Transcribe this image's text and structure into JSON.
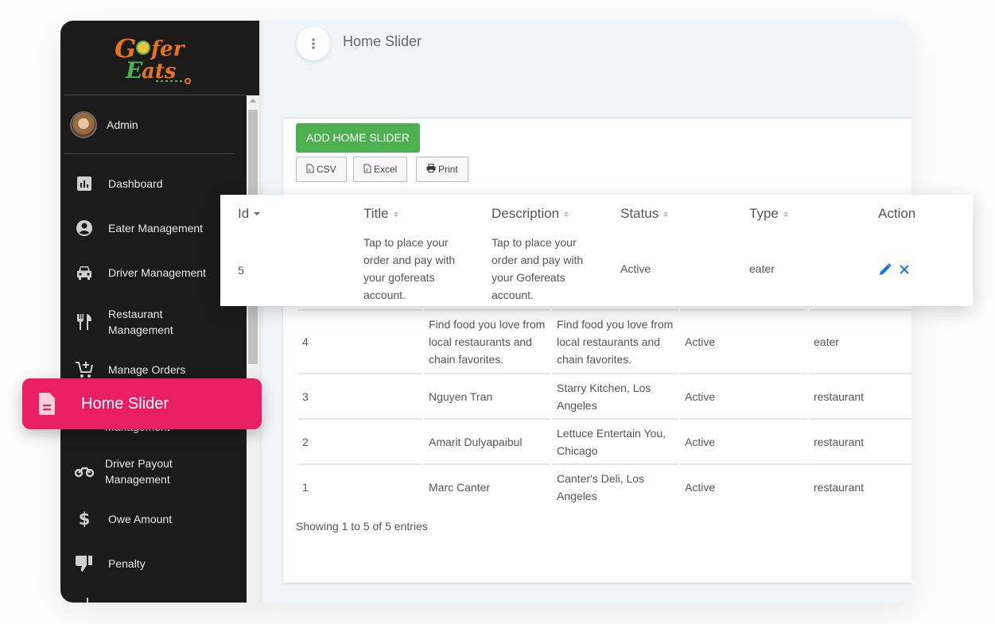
{
  "brand": {
    "logo_text_top": "Gofer",
    "logo_text_bottom": "Eats"
  },
  "user": {
    "name": "Admin"
  },
  "sidebar": {
    "items": [
      {
        "label": "Dashboard",
        "icon": "bar-chart-icon"
      },
      {
        "label": "Eater Management",
        "icon": "user-circle-icon"
      },
      {
        "label": "Driver Management",
        "icon": "car-icon"
      },
      {
        "label": "Restaurant Management",
        "icon": "restaurant-icon"
      },
      {
        "label": "Manage Orders",
        "icon": "cart-plus-icon"
      },
      {
        "label": "Home Slider",
        "icon": "document-icon",
        "active": true
      },
      {
        "label": "Driver Payout Management",
        "icon": "motorbike-icon"
      },
      {
        "label": "Owe Amount",
        "icon": "dollar-icon"
      },
      {
        "label": "Penalty",
        "icon": "thumbs-down-icon"
      }
    ],
    "hidden_item_fragment": "Management"
  },
  "header": {
    "title": "Home Slider",
    "menu_icon": "more-vertical-icon"
  },
  "toolbar": {
    "add_label": "ADD HOME SLIDER",
    "csv_label": "CSV",
    "excel_label": "Excel",
    "print_label": "Print"
  },
  "table": {
    "columns": [
      "Id",
      "Title",
      "Description",
      "Status",
      "Type",
      "Action"
    ],
    "sort": {
      "column": "Id",
      "direction": "desc"
    },
    "rows": [
      {
        "id": "5",
        "title": "Tap to place your order and pay with your gofereats account.",
        "description": "Tap to place your order and pay with your Gofereats account.",
        "status": "Active",
        "type": "eater"
      },
      {
        "id": "4",
        "title": "Find food you love from local restaurants and chain favorites.",
        "description": "Find food you love from local restaurants and chain favorites.",
        "status": "Active",
        "type": "eater"
      },
      {
        "id": "3",
        "title": "Nguyen Tran",
        "description": "Starry Kitchen, Los Angeles",
        "status": "Active",
        "type": "restaurant"
      },
      {
        "id": "2",
        "title": "Amarit Dulyapaibul",
        "description": "Lettuce Entertain You, Chicago",
        "status": "Active",
        "type": "restaurant"
      },
      {
        "id": "1",
        "title": "Marc Canter",
        "description": "Canter's Deli, Los Angeles",
        "status": "Active",
        "type": "restaurant"
      }
    ],
    "info": "Showing 1 to 5 of 5 entries"
  },
  "colors": {
    "accent": "#e91e63",
    "add_button": "#4caf50",
    "action_icon": "#1a73e8",
    "sidebar_bg": "#1b1b1b"
  }
}
